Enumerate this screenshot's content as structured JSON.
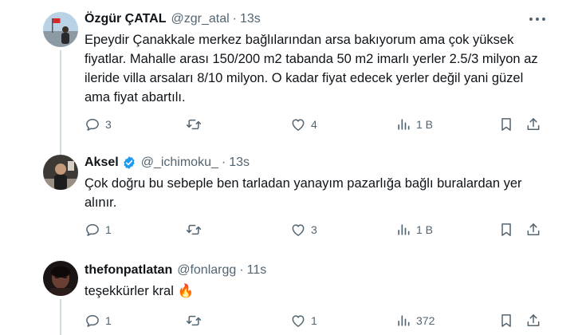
{
  "tweets": [
    {
      "name": "Özgür ÇATAL",
      "handle": "@zgr_atal",
      "time": "13s",
      "verified": false,
      "text": "Epeydir Çanakkale merkez bağlılarından arsa bakıyorum ama çok yüksek fiyatlar. Mahalle arası 150/200 m2 tabanda 50 m2 imarlı yerler 2.5/3 milyon az ileride villa arsaları 8/10 milyon. O kadar fiyat edecek yerler değil yani güzel ama fiyat abartılı.",
      "replies": "3",
      "retweets": "",
      "likes": "4",
      "views": "1 B"
    },
    {
      "name": "Aksel",
      "handle": "@_ichimoku_",
      "time": "13s",
      "verified": true,
      "text": "Çok doğru bu sebeple ben tarladan yanayım pazarlığa bağlı buralardan yer alınır.",
      "replies": "1",
      "retweets": "",
      "likes": "3",
      "views": "1 B"
    },
    {
      "name": "thefonpatlatan",
      "handle": "@fonlargg",
      "time": "11s",
      "verified": false,
      "text": "teşekkürler kral",
      "emoji": "🔥",
      "replies": "1",
      "retweets": "",
      "likes": "1",
      "views": "372"
    }
  ],
  "icons": {
    "reply": "reply-icon",
    "retweet": "retweet-icon",
    "like": "heart-icon",
    "views": "views-icon",
    "bookmark": "bookmark-icon",
    "share": "share-icon",
    "more": "more-icon",
    "verified": "verified-badge-icon"
  },
  "colors": {
    "text": "#0f1419",
    "secondary": "#536471",
    "verified": "#1d9bf0",
    "fire": "#f4900c",
    "thread_line": "#cfd9de"
  }
}
